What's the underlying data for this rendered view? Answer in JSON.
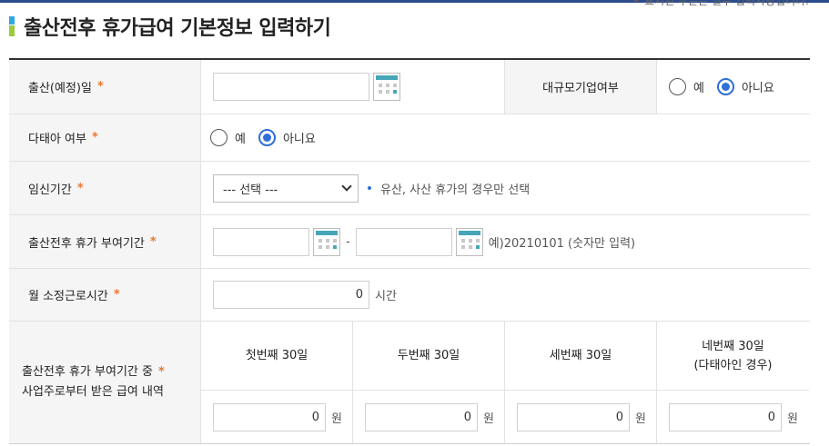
{
  "note": {
    "text": "표시된 부분은 필수 입력사항입니다."
  },
  "page_title": "출산전후 휴가급여 기본정보 입력하기",
  "fields": {
    "birth_date": {
      "label": "출산(예정)일",
      "value": ""
    },
    "large_company": {
      "label": "대규모기업여부",
      "yes": "예",
      "no": "아니요",
      "selected": "아니요"
    },
    "multiple_birth": {
      "label": "다태아 여부",
      "yes": "예",
      "no": "아니요",
      "selected": "아니요"
    },
    "pregnancy_period": {
      "label": "임신기간",
      "selected": "--- 선택 ---",
      "hint": "유산, 사산 휴가의 경우만 선택"
    },
    "leave_period": {
      "label": "출산전후 휴가 부여기간",
      "start": "",
      "end": "",
      "separator": "-",
      "hint": "예)20210101 (숫자만 입력)"
    },
    "monthly_hours": {
      "label": "월 소정근로시간",
      "value": "0",
      "unit": "시간"
    },
    "employer_pay": {
      "label_line1": "출산전후 휴가 부여기간 중",
      "label_line2": "사업주로부터 받은 급여 내역",
      "columns": [
        {
          "line1": "첫번째 30일",
          "line2": "",
          "value": "0",
          "unit": "원"
        },
        {
          "line1": "두번째 30일",
          "line2": "",
          "value": "0",
          "unit": "원"
        },
        {
          "line1": "세번째 30일",
          "line2": "",
          "value": "0",
          "unit": "원"
        },
        {
          "line1": "네번째 30일",
          "line2": "(다태아인 경우)",
          "value": "0",
          "unit": "원"
        }
      ]
    }
  },
  "required_marker": "*",
  "colors": {
    "accent": "#2f6fd6",
    "required": "#e8772e",
    "header_bg": "#f5f5f5",
    "calendar": "#46a6b8"
  }
}
